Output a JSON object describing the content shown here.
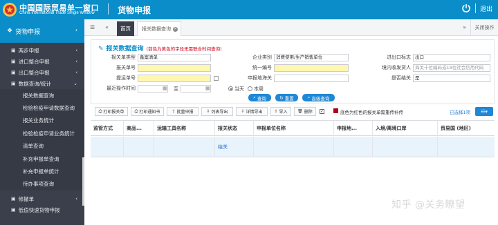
{
  "header": {
    "brand_cn": "中国国际贸易单一窗口",
    "brand_en": "China International Trade Single Window",
    "system_title": "货物申报",
    "exit_label": "退出"
  },
  "sidebar": {
    "section_title": "货物申报",
    "items": [
      {
        "label": "两步申报"
      },
      {
        "label": "进口整合申报"
      },
      {
        "label": "出口整合申报"
      },
      {
        "label": "数据查询/统计"
      }
    ],
    "sub_items": [
      {
        "label": "报关数据查询"
      },
      {
        "label": "检验检疫申请数据查询"
      },
      {
        "label": "报关业务统计"
      },
      {
        "label": "检验检疫申请业务统计"
      },
      {
        "label": "清单查询"
      },
      {
        "label": "补充申报单查询"
      },
      {
        "label": "补充申报单统计"
      },
      {
        "label": "待办事项查询"
      }
    ],
    "bottom_items": [
      {
        "label": "修撤单"
      },
      {
        "label": "低值快速货物申报"
      }
    ]
  },
  "tabs": {
    "home": "首页",
    "active": "报关数据查询",
    "close_ops": "关闭操作"
  },
  "query": {
    "title": "报关数据查询",
    "note": "(前色为黄色的字段无需联合时间查询)",
    "labels": {
      "decl_type": "报关单类型",
      "entry_no": "报关单号",
      "bill_no": "提运单号",
      "last_op_time": "最近操作时间",
      "to": "至",
      "ent_type": "企业类别",
      "uni_no": "统一编号",
      "customs": "申报地海关",
      "ie_flag": "进出口标志",
      "consignee": "境内收发货人",
      "is_end": "是否结关"
    },
    "values": {
      "decl_type": "备案清单",
      "ent_type": "消费使用/生产销售单位",
      "ie_flag": "出口",
      "consignee_placeholder": "海关十位编码或18位社会信用代码",
      "is_end": "是"
    },
    "radio": {
      "today": "当天",
      "week": "本周"
    },
    "buttons": {
      "search": "查询",
      "reset": "重置",
      "advanced": "高级查询"
    }
  },
  "toolbar": {
    "buttons": [
      "打印报关单",
      "打印通知书",
      "批量申报",
      "列表导出",
      "详情导出",
      "导入",
      "删除"
    ],
    "legend": "底色为红色的报关单需重传补传",
    "selected": "已选择1项"
  },
  "table": {
    "columns": [
      "监管方式",
      "商品...",
      "运输工具名称",
      "报关状态",
      "申报单位名称",
      "申报地...",
      "入境/离境口岸",
      "贸易国 (地区)"
    ],
    "rows": [
      {
        "status": "结关"
      }
    ]
  },
  "watermark": "知乎 @关务瞭望",
  "colors": {
    "brand_blue": "#0a8dc9",
    "sidebar_bg": "#3a3f4b",
    "highlight_yellow": "#fff6b0",
    "legend_red": "#b0001e"
  }
}
